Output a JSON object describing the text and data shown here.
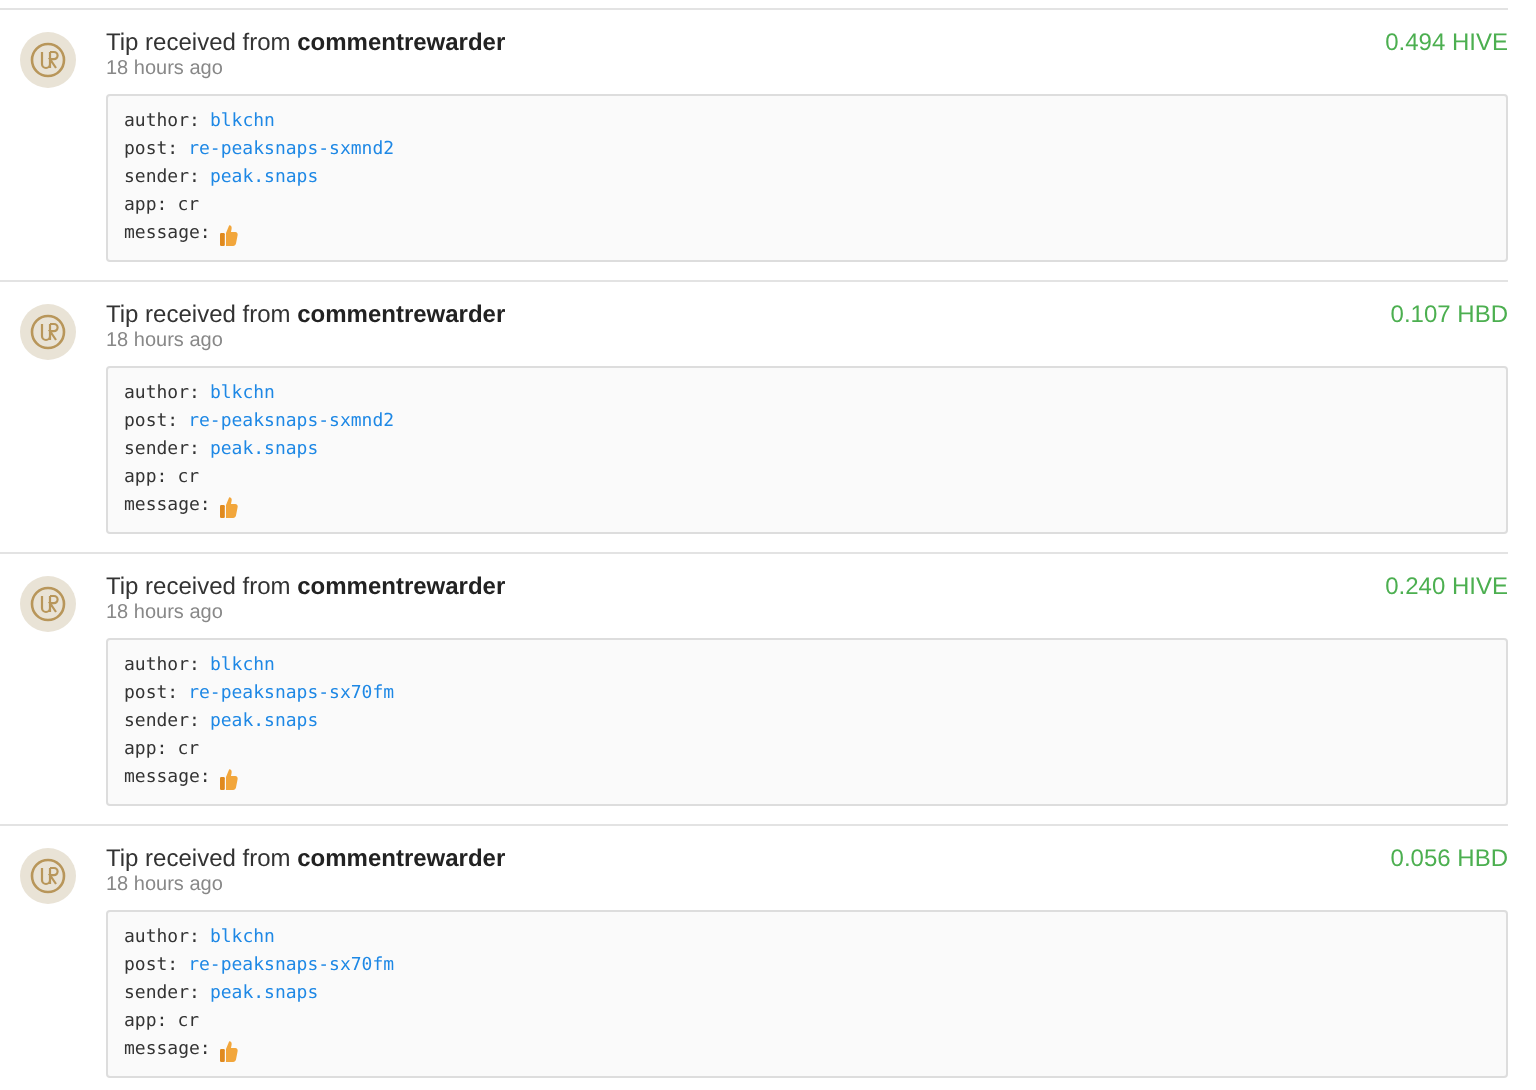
{
  "tips": [
    {
      "title": "Tip received from ",
      "sender": "commentrewarder",
      "time": "18 hours ago",
      "amount": "0.494 HIVE",
      "fields": [
        {
          "key": "author:",
          "value": "blkchn",
          "kind": "link"
        },
        {
          "key": "post:",
          "value": "re-peaksnaps-sxmnd2",
          "kind": "link"
        },
        {
          "key": "sender:",
          "value": "peak.snaps",
          "kind": "link"
        },
        {
          "key": "app:",
          "value": "cr",
          "kind": "text"
        },
        {
          "key": "message:",
          "kind": "thumb"
        }
      ]
    },
    {
      "title": "Tip received from ",
      "sender": "commentrewarder",
      "time": "18 hours ago",
      "amount": "0.107 HBD",
      "fields": [
        {
          "key": "author:",
          "value": "blkchn",
          "kind": "link"
        },
        {
          "key": "post:",
          "value": "re-peaksnaps-sxmnd2",
          "kind": "link"
        },
        {
          "key": "sender:",
          "value": "peak.snaps",
          "kind": "link"
        },
        {
          "key": "app:",
          "value": "cr",
          "kind": "text"
        },
        {
          "key": "message:",
          "kind": "thumb"
        }
      ]
    },
    {
      "title": "Tip received from ",
      "sender": "commentrewarder",
      "time": "18 hours ago",
      "amount": "0.240 HIVE",
      "fields": [
        {
          "key": "author:",
          "value": "blkchn",
          "kind": "link"
        },
        {
          "key": "post:",
          "value": "re-peaksnaps-sx70fm",
          "kind": "link"
        },
        {
          "key": "sender:",
          "value": "peak.snaps",
          "kind": "link"
        },
        {
          "key": "app:",
          "value": "cr",
          "kind": "text"
        },
        {
          "key": "message:",
          "kind": "thumb"
        }
      ]
    },
    {
      "title": "Tip received from ",
      "sender": "commentrewarder",
      "time": "18 hours ago",
      "amount": "0.056 HBD",
      "fields": [
        {
          "key": "author:",
          "value": "blkchn",
          "kind": "link"
        },
        {
          "key": "post:",
          "value": "re-peaksnaps-sx70fm",
          "kind": "link"
        },
        {
          "key": "sender:",
          "value": "peak.snaps",
          "kind": "link"
        },
        {
          "key": "app:",
          "value": "cr",
          "kind": "text"
        },
        {
          "key": "message:",
          "kind": "thumb"
        }
      ]
    }
  ]
}
